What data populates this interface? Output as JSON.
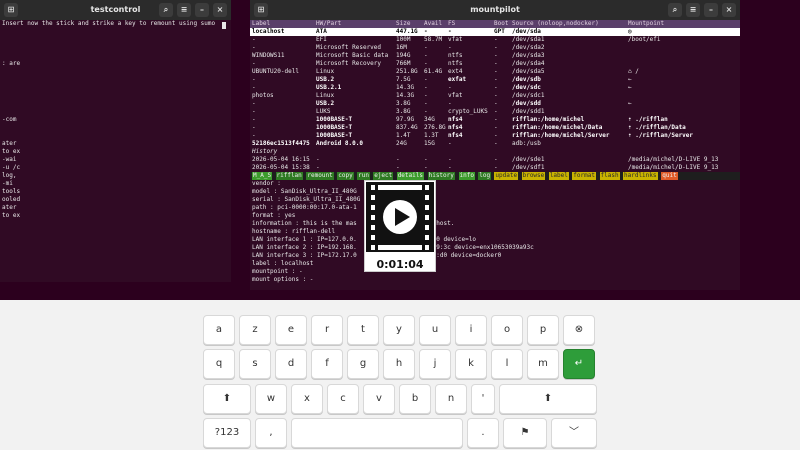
{
  "left_window": {
    "title": "testcontrol",
    "lines": [
      "Insert now the stick and strike a key to remount using sumo",
      "",
      "",
      "",
      "",
      ": are",
      "",
      "",
      "",
      "",
      "",
      "",
      "-com",
      "",
      "",
      "ater",
      "to ex",
      "-wai",
      "-u /c",
      "log,",
      "-mi",
      "tools",
      "ooled",
      "ater",
      "to ex"
    ]
  },
  "right_window": {
    "title": "mountpilot",
    "columns": [
      "Label",
      "HW/Part",
      "Size",
      "Avail",
      "FS",
      "Boot",
      "Source (noloop,nodocker)",
      "Mountpoint"
    ],
    "rows": [
      [
        "localhost",
        "ATA",
        "447.1G",
        "-",
        "-",
        "GPT",
        "/dev/sda",
        "◎"
      ],
      [
        "-",
        "EFI",
        "100M",
        "58.7M",
        "vfat",
        "-",
        "/dev/sda1",
        "/boot/efi"
      ],
      [
        "-",
        "Microsoft Reserved",
        "16M",
        "-",
        "-",
        "-",
        "/dev/sda2",
        ""
      ],
      [
        "WINDOWS11",
        "Microsoft Basic data",
        "194G",
        "-",
        "ntfs",
        "-",
        "/dev/sda3",
        ""
      ],
      [
        "-",
        "Microsoft Recovery",
        "766M",
        "-",
        "ntfs",
        "-",
        "/dev/sda4",
        ""
      ],
      [
        "UBUNTU20-dell",
        "Linux",
        "251.8G",
        "61.4G",
        "ext4",
        "-",
        "/dev/sda5",
        "⌂ /"
      ],
      [
        "-",
        "USB.2",
        "7.5G",
        "-",
        "exfat",
        "-",
        "/dev/sdb",
        "←"
      ],
      [
        "-",
        "USB.2.1",
        "14.3G",
        "-",
        "-",
        "-",
        "/dev/sdc",
        "←"
      ],
      [
        "photos",
        "Linux",
        "14.3G",
        "-",
        "vfat",
        "-",
        "/dev/sdc1",
        ""
      ],
      [
        "-",
        "USB.2",
        "3.8G",
        "-",
        "-",
        "-",
        "/dev/sdd",
        "←"
      ],
      [
        "-",
        "LUKS",
        "3.8G",
        "-",
        "crypto_LUKS",
        "-",
        "/dev/sdd1",
        ""
      ],
      [
        "-",
        "1000BASE-T",
        "97.9G",
        "34G",
        "nfs4",
        "-",
        "rifflan:/home/michel",
        "⇡ ./rifflan"
      ],
      [
        "-",
        "1000BASE-T",
        "837.4G",
        "276.8G",
        "nfs4",
        "-",
        "rifflan:/home/michel/Data",
        "⇡ ./rifflan/Data"
      ],
      [
        "-",
        "1000BASE-T",
        "1.4T",
        "1.3T",
        "nfs4",
        "-",
        "rifflan:/home/michel/Server",
        "⇡ ./rifflan/Server"
      ],
      [
        "52186ec1513f4475",
        "Android 8.0.0",
        "24G",
        "15G",
        "-",
        "-",
        "adb:/usb",
        ""
      ]
    ],
    "history_label": "History",
    "history": [
      [
        "2026-05-04 16:15",
        "-",
        "-",
        "-",
        "-",
        "-",
        "/dev/sde1",
        "/media/michel/D-LIVE 9_13"
      ],
      [
        "2026-05-04 15:38",
        "-",
        "-",
        "-",
        "-",
        "-",
        "/dev/sdf1",
        "/media/michel/D-LIVE 9_13"
      ]
    ],
    "menu": [
      "M_A_S",
      "rifflan",
      "remount",
      "copy",
      "run",
      "eject",
      "details",
      "history",
      "info",
      "log",
      "update",
      "browse",
      "label",
      "format",
      "flash",
      "hardlinks",
      "quit"
    ],
    "details_lines": [
      "vendor :",
      "model : SanDisk_Ultra_II_480G",
      "serial : SanDisk_Ultra_II_480G",
      "path : pci-0000:00:17.0-ata-1",
      "format : yes",
      "information : this is the mas                 localhost.",
      "hostname : rifflan-dell",
      "LAN interface 1 : IP=127.0.0.                 :00:00 device=lo",
      "LAN interface 2 : IP=192.168.                 :39:a9:3c device=enx10653039a93c",
      "LAN interface 3 : IP=172.17.0                 ae:25:d0 device=docker0",
      "label : localhost",
      "mountpoint : -",
      "mount options : -"
    ]
  },
  "video": {
    "duration": "0:01:04"
  },
  "keyboard": {
    "row1": [
      "a",
      "z",
      "e",
      "r",
      "t",
      "y",
      "u",
      "i",
      "o",
      "p",
      "⊗"
    ],
    "row2": [
      "q",
      "s",
      "d",
      "f",
      "g",
      "h",
      "j",
      "k",
      "l",
      "m",
      "↵"
    ],
    "row3": [
      "⬆",
      "w",
      "x",
      "c",
      "v",
      "b",
      "n",
      "'",
      "⬆"
    ],
    "row4": [
      "?123",
      ",",
      "",
      ".",
      "⚑",
      "﹀"
    ]
  },
  "colors": {
    "terminal_bg": "#300a24",
    "desktop_bg": "#2c001e",
    "header_bg": "#5a3f6a",
    "selected_row_bg": "#ffffff",
    "enter_key": "#2e9d3a",
    "menu_green": "#3c9c2c",
    "menu_yellow": "#c9b300"
  }
}
